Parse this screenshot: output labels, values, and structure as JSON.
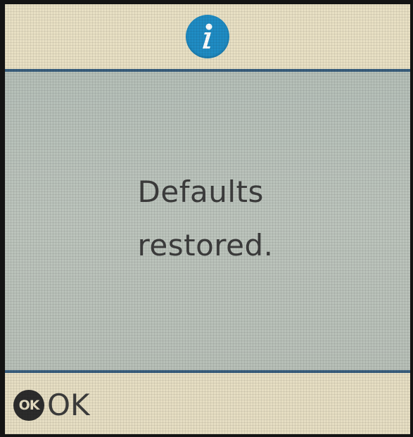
{
  "header": {
    "icon": "info-icon",
    "icon_color": "#1f8cc4"
  },
  "message": {
    "line1": "Defaults",
    "line2": "restored."
  },
  "footer": {
    "ok_badge": "OK",
    "ok_label": "OK"
  },
  "colors": {
    "header_bg": "#e8e0c4",
    "body_bg": "#b9c1ba",
    "divider": "#3a5f7e",
    "text": "#3c3c3c"
  }
}
